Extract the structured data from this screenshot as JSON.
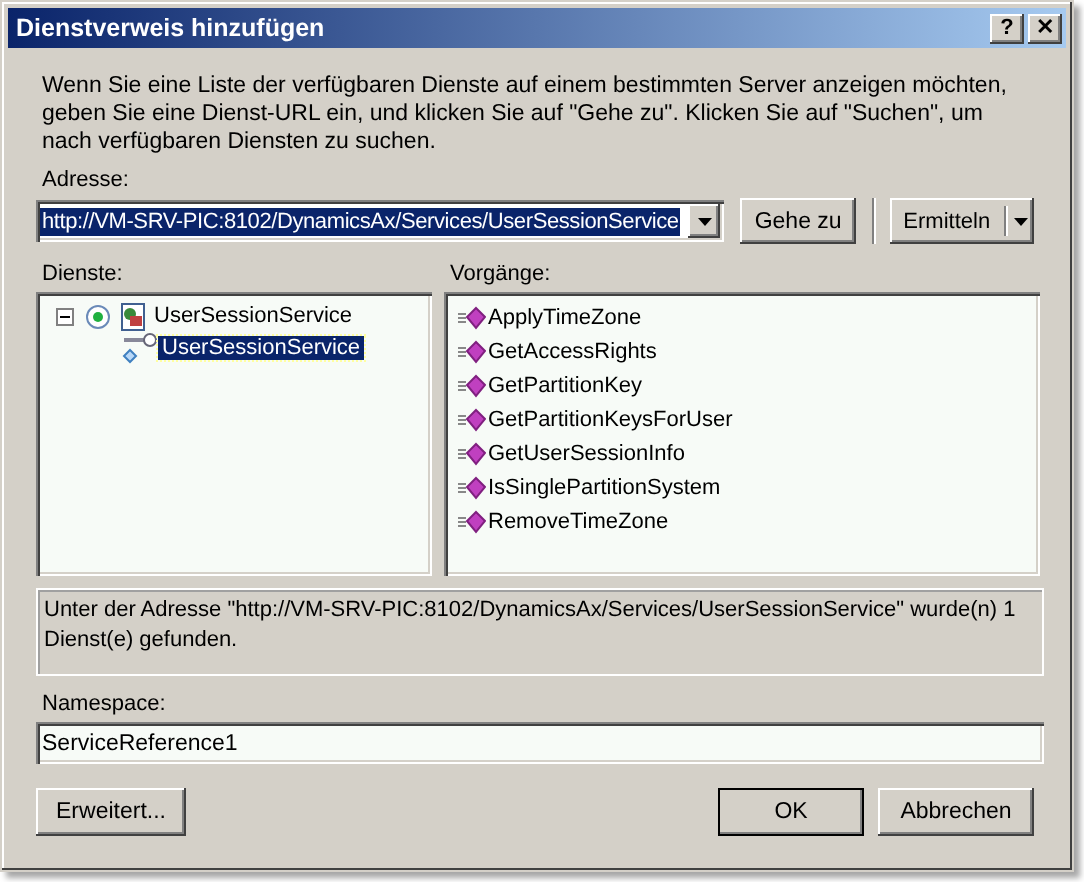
{
  "window": {
    "title": "Dienstverweis hinzufügen",
    "buttons": [
      "?",
      "✕"
    ]
  },
  "description": "Wenn Sie eine Liste der verfügbaren Dienste auf einem bestimmten Server anzeigen möchten, geben Sie eine Dienst-URL ein, und klicken Sie auf \"Gehe zu\". Klicken Sie auf \"Suchen\", um nach verfügbaren Diensten zu suchen.",
  "address": {
    "label": "Adresse:",
    "value": "http://VM-SRV-PIC:8102/DynamicsAx/Services/UserSessionService",
    "selected": true
  },
  "go_button": "Gehe zu",
  "discover_button": "Ermitteln",
  "services": {
    "label": "Dienste:",
    "items": [
      {
        "label": "UserSessionService",
        "expanded": true,
        "selected": false,
        "children": [
          {
            "label": "UserSessionService",
            "selected": true
          }
        ]
      }
    ]
  },
  "operations": {
    "label": "Vorgänge:",
    "items": [
      "ApplyTimeZone",
      "GetAccessRights",
      "GetPartitionKey",
      "GetPartitionKeysForUser",
      "GetUserSessionInfo",
      "IsSinglePartitionSystem",
      "RemoveTimeZone"
    ]
  },
  "status": "Unter der Adresse \"http://VM-SRV-PIC:8102/DynamicsAx/Services/UserSessionService\" wurde(n) 1 Dienst(e) gefunden.",
  "namespace": {
    "label": "Namespace:",
    "value": "ServiceReference1"
  },
  "advanced_button": "Erweitert...",
  "buttons": [
    {
      "label": "OK",
      "default": true
    },
    {
      "label": "Abbrechen",
      "default": false
    }
  ]
}
